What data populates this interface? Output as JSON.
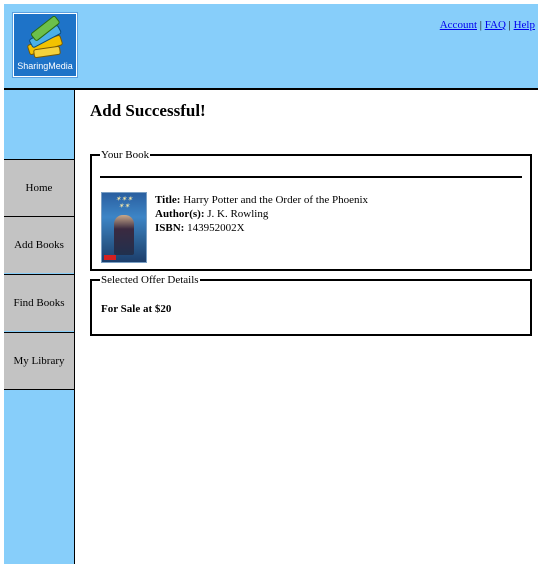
{
  "header": {
    "logo_text": "SharingMedia",
    "links": [
      "Account",
      "FAQ",
      "Help"
    ],
    "separator": "|"
  },
  "sidebar": {
    "items": [
      {
        "label": "Home"
      },
      {
        "label": "Add Books"
      },
      {
        "label": "Find Books"
      },
      {
        "label": "My Library"
      }
    ]
  },
  "main": {
    "title": "Add Successful!",
    "book_section": {
      "legend": "Your Book",
      "title_label": "Title:",
      "title_value": "Harry Potter and the Order of the Phoenix",
      "author_label": "Author(s):",
      "author_value": "J. K. Rowling",
      "isbn_label": "ISBN:",
      "isbn_value": "143952002X",
      "cover_icon": "book-cover-image"
    },
    "offer_section": {
      "legend": "Selected Offer Details",
      "offer_text": "For Sale at $20"
    }
  },
  "colors": {
    "header_bg": "#87cefa",
    "sidebar_bg": "#87cefa",
    "nav_item_bg": "#c3c3c3",
    "link": "#0000ee",
    "logo_bg": "#1e73c8"
  }
}
